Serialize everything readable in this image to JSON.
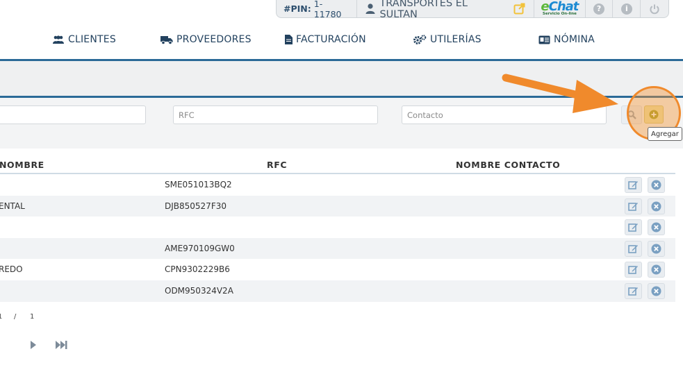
{
  "topbar": {
    "pin_label": "#PIN:",
    "pin_value": "1-11780",
    "company": "TRANSPORTES EL SULTAN",
    "echat_main": "eChat",
    "echat_sub": "Servicio On-line",
    "help_symbol": "?",
    "info_symbol": "i"
  },
  "nav": {
    "items": [
      {
        "label": "CLIENTES",
        "icon": "users-icon"
      },
      {
        "label": "PROVEEDORES",
        "icon": "truck-icon"
      },
      {
        "label": "FACTURACIÓN",
        "icon": "file-icon"
      },
      {
        "label": "UTILERÍAS",
        "icon": "cogs-icon"
      },
      {
        "label": "NÓMINA",
        "icon": "id-card-icon"
      }
    ]
  },
  "filters": {
    "name_placeholder": "",
    "rfc_placeholder": "RFC",
    "contact_placeholder": "Contacto"
  },
  "actions": {
    "add_tooltip": "Agregar"
  },
  "table": {
    "headers": [
      "NOMBRE",
      "RFC",
      "NOMBRE CONTACTO"
    ],
    "rows": [
      {
        "name": "",
        "rfc": "SME051013BQ2",
        "contact": ""
      },
      {
        "name": "ENTAL",
        "rfc": "DJB850527F30",
        "contact": ""
      },
      {
        "name": "",
        "rfc": "",
        "contact": ""
      },
      {
        "name": "",
        "rfc": "AME970109GW0",
        "contact": ""
      },
      {
        "name": "REDO",
        "rfc": "CPN9302229B6",
        "contact": ""
      },
      {
        "name": "",
        "rfc": "ODM950324V2A",
        "contact": ""
      }
    ]
  },
  "pager": {
    "current": "1",
    "separator": "/",
    "total": "1"
  },
  "colors": {
    "accent": "#2b6a97",
    "nav_text": "#23425f",
    "highlight": "#f08a2c",
    "add_button": "#ece6a9"
  }
}
